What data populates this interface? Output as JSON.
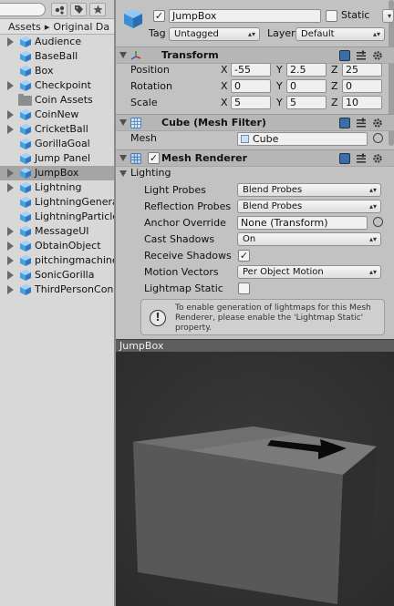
{
  "project": {
    "breadcrumb": [
      "Assets",
      "Original Da"
    ],
    "breadcrumb_sep": "▸",
    "toolbar_icons": [
      "lock-icon",
      "tag-icon",
      "star-icon"
    ],
    "assets": [
      {
        "name": "Audience",
        "icon": "prefab-cube",
        "foldout": true,
        "selected": false
      },
      {
        "name": "BaseBall",
        "icon": "prefab-cube",
        "foldout": false,
        "selected": false
      },
      {
        "name": "Box",
        "icon": "prefab-cube",
        "foldout": false,
        "selected": false
      },
      {
        "name": "Checkpoint",
        "icon": "prefab-cube",
        "foldout": true,
        "selected": false
      },
      {
        "name": "Coin Assets",
        "icon": "folder",
        "foldout": false,
        "selected": false
      },
      {
        "name": "CoinNew",
        "icon": "prefab-cube",
        "foldout": true,
        "selected": false
      },
      {
        "name": "CricketBall",
        "icon": "prefab-cube",
        "foldout": true,
        "selected": false
      },
      {
        "name": "GorillaGoal",
        "icon": "prefab-cube",
        "foldout": false,
        "selected": false
      },
      {
        "name": "Jump Panel",
        "icon": "prefab-cube",
        "foldout": false,
        "selected": false
      },
      {
        "name": "JumpBox",
        "icon": "prefab-cube",
        "foldout": true,
        "selected": true
      },
      {
        "name": "Lightning",
        "icon": "prefab-cube",
        "foldout": true,
        "selected": false
      },
      {
        "name": "LightningGenera",
        "icon": "prefab-cube",
        "foldout": false,
        "selected": false
      },
      {
        "name": "LightningParticle",
        "icon": "prefab-cube",
        "foldout": false,
        "selected": false
      },
      {
        "name": "MessageUI",
        "icon": "prefab-cube",
        "foldout": true,
        "selected": false
      },
      {
        "name": "ObtainObject",
        "icon": "prefab-cube",
        "foldout": true,
        "selected": false
      },
      {
        "name": "pitchingmachine",
        "icon": "prefab-cube",
        "foldout": true,
        "selected": false
      },
      {
        "name": "SonicGorilla",
        "icon": "prefab-cube",
        "foldout": true,
        "selected": false
      },
      {
        "name": "ThirdPersonCon",
        "icon": "prefab-cube",
        "foldout": true,
        "selected": false
      }
    ]
  },
  "inspector": {
    "object": {
      "active": true,
      "name": "JumpBox",
      "static_label": "Static",
      "static_checked": false,
      "tag_label": "Tag",
      "tag_value": "Untagged",
      "layer_label": "Layer",
      "layer_value": "Default"
    },
    "transform": {
      "title": "Transform",
      "position_label": "Position",
      "rotation_label": "Rotation",
      "scale_label": "Scale",
      "axes": [
        "X",
        "Y",
        "Z"
      ],
      "position": [
        "-55",
        "2.5",
        "25"
      ],
      "rotation": [
        "0",
        "0",
        "0"
      ],
      "scale": [
        "5",
        "5",
        "10"
      ]
    },
    "mesh_filter": {
      "title": "Cube (Mesh Filter)",
      "mesh_label": "Mesh",
      "mesh_value": "Cube"
    },
    "mesh_renderer": {
      "title": "Mesh Renderer",
      "enabled": true,
      "section": "Lighting",
      "light_probes_label": "Light Probes",
      "light_probes_value": "Blend Probes",
      "reflection_probes_label": "Reflection Probes",
      "reflection_probes_value": "Blend Probes",
      "anchor_override_label": "Anchor Override",
      "anchor_override_value": "None (Transform)",
      "cast_shadows_label": "Cast Shadows",
      "cast_shadows_value": "On",
      "receive_shadows_label": "Receive Shadows",
      "receive_shadows_checked": true,
      "motion_vectors_label": "Motion Vectors",
      "motion_vectors_value": "Per Object Motion",
      "lightmap_static_label": "Lightmap Static",
      "lightmap_static_checked": false,
      "info_text": "To enable generation of lightmaps for this Mesh Renderer, please enable the 'Lightmap Static' property."
    }
  },
  "preview": {
    "title": "JumpBox"
  },
  "colors": {
    "selection": "#a5a5a5",
    "prefab_blue": "#4a9fe0",
    "preview_bg": "#333333"
  }
}
